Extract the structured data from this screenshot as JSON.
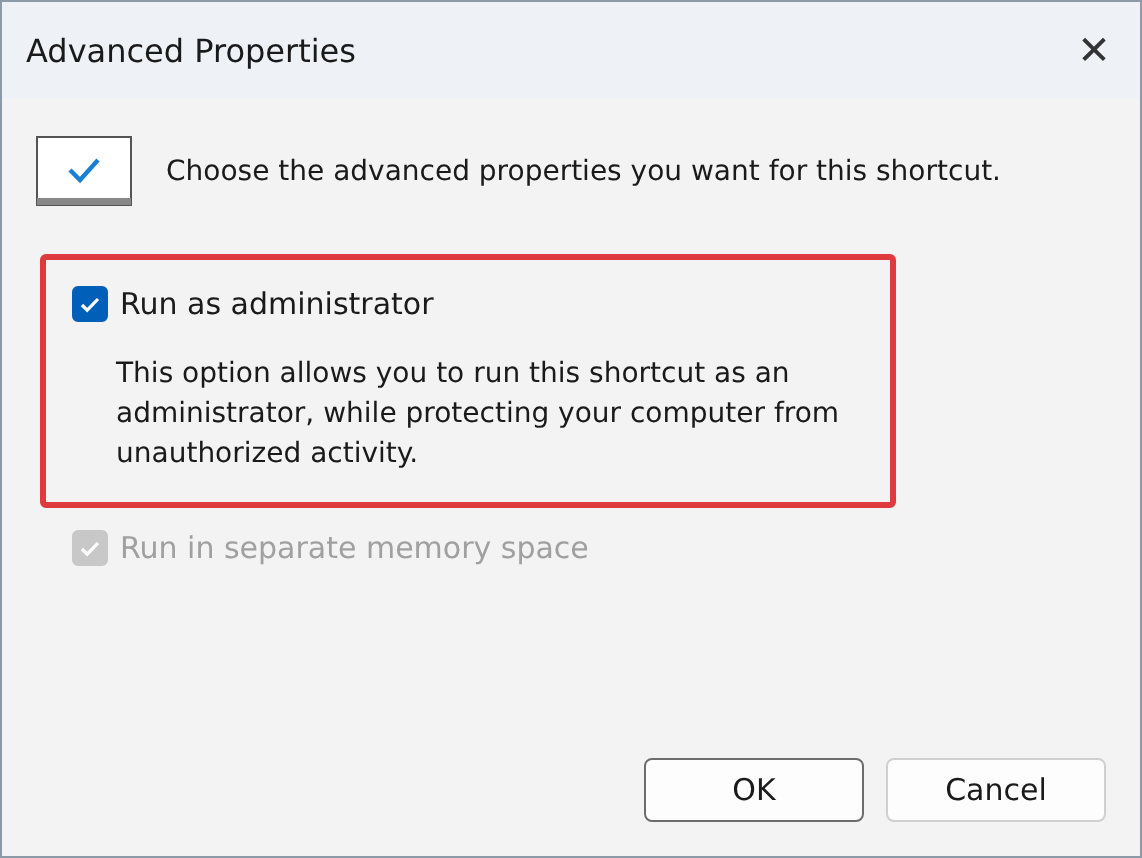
{
  "window": {
    "title": "Advanced Properties",
    "close_glyph": "✕"
  },
  "intro": {
    "text": "Choose the advanced properties you want for this shortcut."
  },
  "options": [
    {
      "label": "Run as administrator",
      "checked": true,
      "disabled": false,
      "highlighted": true,
      "description": "This option allows you to run this shortcut as an administrator, while protecting your computer from unauthorized activity."
    },
    {
      "label": "Run in separate memory space",
      "checked": true,
      "disabled": true,
      "highlighted": false
    }
  ],
  "buttons": [
    {
      "label": "OK",
      "default": true
    },
    {
      "label": "Cancel",
      "default": false
    }
  ]
}
